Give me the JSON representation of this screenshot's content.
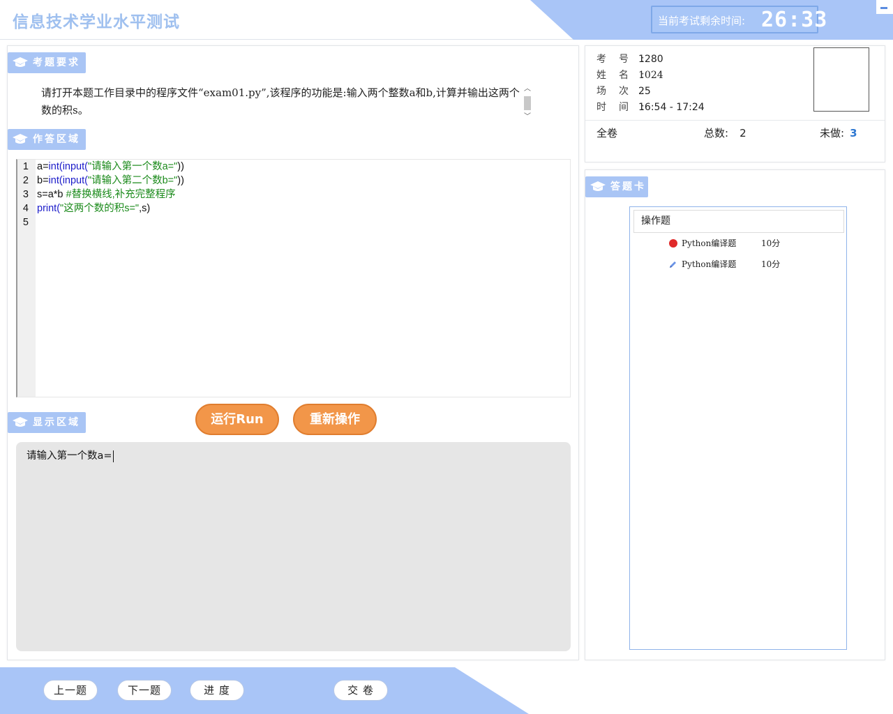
{
  "header": {
    "app_title": "信息技术学业水平测试",
    "timer_label": "当前考试剩余时间:",
    "timer_value": "26:33"
  },
  "question": {
    "section_label": "考题要求",
    "text": "请打开本题工作目录中的程序文件“exam01.py”,该程序的功能是:输入两个整数a和b,计算并输出这两个数的积s。"
  },
  "editor": {
    "section_label": "作答区域",
    "lines": [
      {
        "n": "1",
        "a": "a=",
        "b": "int(input(",
        "c": "\"请输入第一个数a=\"",
        "d": "))"
      },
      {
        "n": "2",
        "a": "b=",
        "b": "int(input(",
        "c": "\"请输入第二个数b=\"",
        "d": "))"
      },
      {
        "n": "3",
        "a": "s=a*b ",
        "b": "",
        "c": "#替换横线,补充完整程序",
        "d": ""
      },
      {
        "n": "4",
        "a": "",
        "b": "print(",
        "c": "\"这两个数的积s=\"",
        "d": ",s)"
      },
      {
        "n": "5",
        "a": "",
        "b": "",
        "c": "",
        "d": ""
      }
    ]
  },
  "actions": {
    "run_label": "运行Run",
    "reset_label": "重新操作"
  },
  "console": {
    "section_label": "显示区域",
    "output": "请输入第一个数a="
  },
  "student": {
    "id_key": "考号:",
    "id_value": "1280",
    "name_key": "姓名:",
    "name_value": "1024",
    "session_key": "场次:",
    "session_value": "25",
    "time_key": "时间:",
    "time_value": "16:54 - 17:24"
  },
  "summary": {
    "scope": "全卷",
    "total_label": "总数:",
    "total_value": "2",
    "undone_label": "未做:",
    "undone_value": "3"
  },
  "answer_card": {
    "section_label": "答题卡",
    "group_title": "操作题",
    "items": [
      {
        "name": "Python编译题",
        "score": "10分",
        "status": "unanswered"
      },
      {
        "name": "Python编译题",
        "score": "10分",
        "status": "current"
      }
    ]
  },
  "footer": {
    "prev_label": "上一题",
    "next_label": "下一题",
    "progress_label": "进 度",
    "submit_label": "交 卷"
  },
  "colors": {
    "accent_blue": "#9fc0f7",
    "run_orange": "#f29649",
    "undone_blue": "#2f78d1",
    "unanswered_red": "#e02a2a"
  },
  "icons": [
    "graduation-cap-icon",
    "red-dot-icon",
    "pencil-icon",
    "minimize-icon",
    "chevron-up-icon",
    "chevron-down-icon"
  ]
}
